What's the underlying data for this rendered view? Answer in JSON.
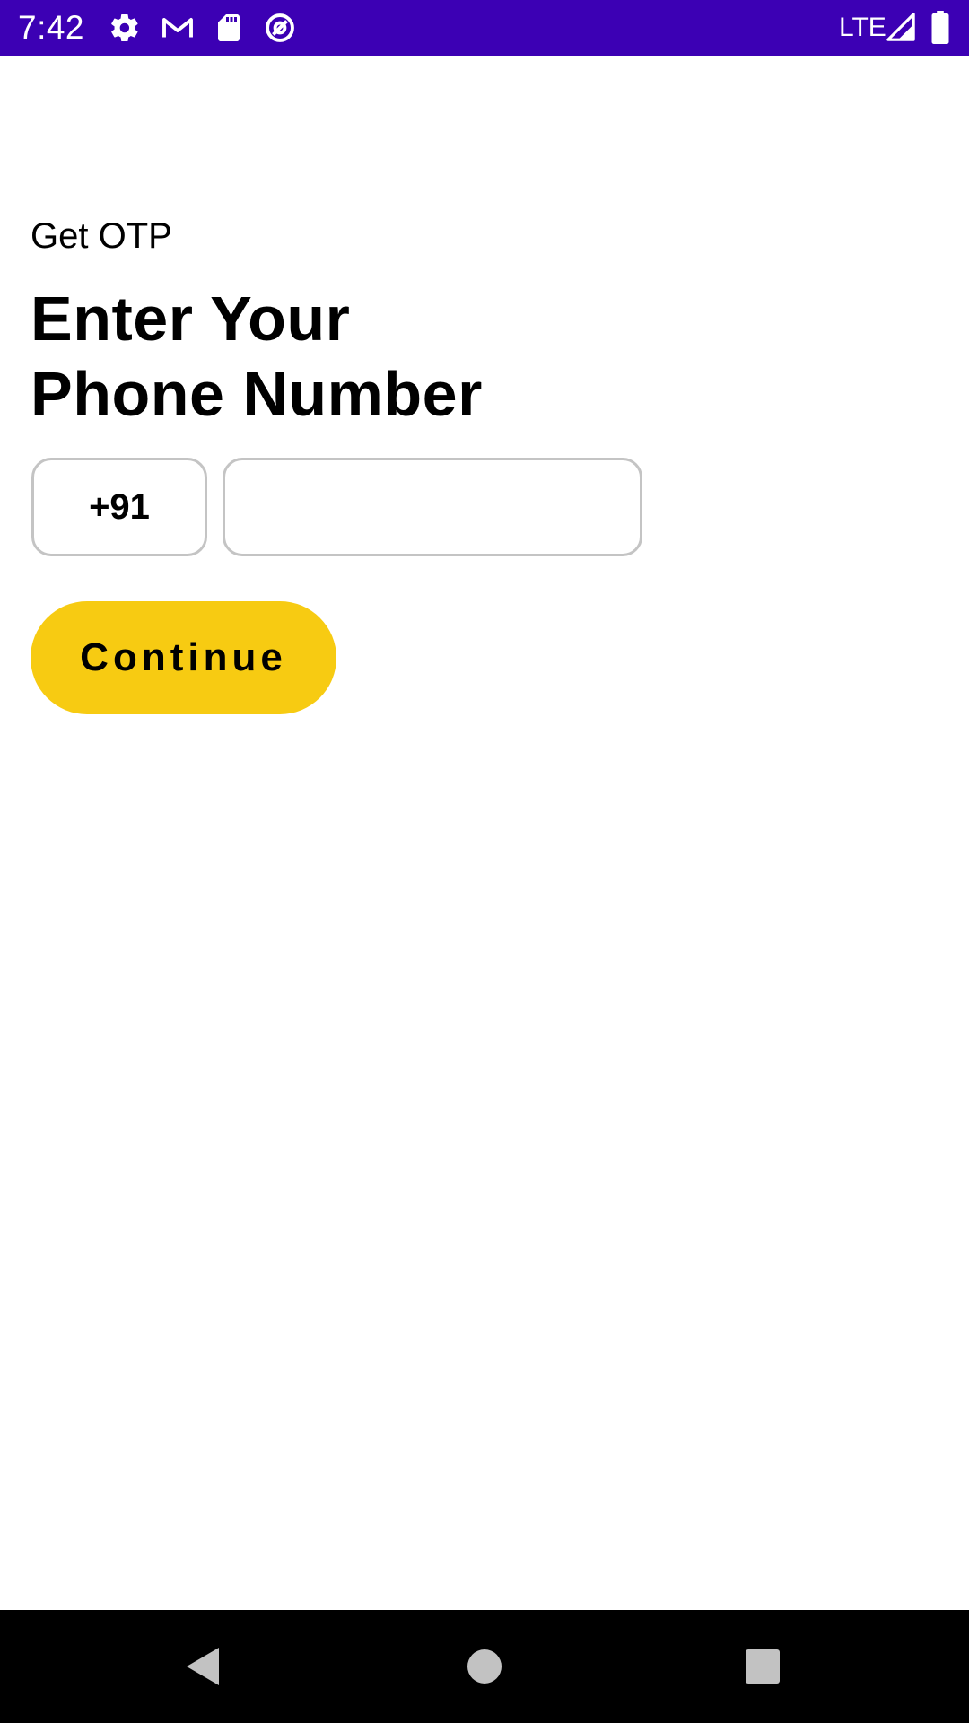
{
  "status_bar": {
    "time": "7:42",
    "network": "LTE",
    "background": "#3c00b4",
    "icons": [
      "gear-icon",
      "gmail-icon",
      "sd-card-icon",
      "at-sign-icon",
      "signal-icon",
      "battery-icon"
    ]
  },
  "screen": {
    "subtitle": "Get OTP",
    "title_line1": "Enter Your",
    "title_line2": "Phone Number",
    "country_code": "+91",
    "phone_value": "",
    "continue_label": "Continue",
    "accent_color": "#f7cb12"
  },
  "nav_bar": {
    "icons": [
      "back-icon",
      "home-icon",
      "recents-icon"
    ]
  }
}
